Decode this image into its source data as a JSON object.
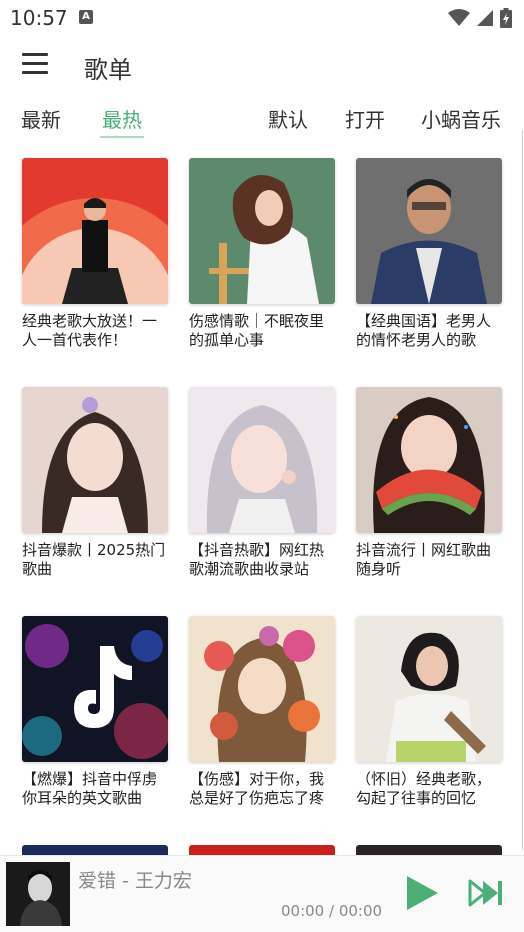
{
  "status_bar": {
    "time": "10:57",
    "a_badge": "A",
    "icons": [
      "wifi-icon",
      "cell-signal-icon",
      "battery-icon"
    ]
  },
  "header": {
    "title": "歌单",
    "menu_icon": "hamburger-menu-icon"
  },
  "tabs": {
    "left": [
      {
        "label": "最新"
      },
      {
        "label": "最热"
      }
    ],
    "right": [
      {
        "label": "默认"
      },
      {
        "label": "打开"
      },
      {
        "label": "小蜗音乐"
      }
    ],
    "active": "最热",
    "accent_color": "#4caf78"
  },
  "playlists": [
    {
      "title": "经典老歌大放送！一人一首代表作！"
    },
    {
      "title": "伤感情歌｜不眠夜里的孤单心事"
    },
    {
      "title": "【经典国语】老男人的情怀老男人的歌"
    },
    {
      "title": "抖音爆款丨2025热门歌曲"
    },
    {
      "title": "【抖音热歌】网红热歌潮流歌曲收录站"
    },
    {
      "title": "抖音流行丨网红歌曲随身听"
    },
    {
      "title": "【燃爆】抖音中俘虏你耳朵的英文歌曲"
    },
    {
      "title": "【伤感】对于你，我总是好了伤疤忘了疼"
    },
    {
      "title": "（怀旧）经典老歌，勾起了往事的回忆"
    }
  ],
  "player": {
    "song": "爱错 - 王力宏",
    "time": "00:00 / 00:00",
    "play_icon": "play-icon",
    "next_icon": "skip-next-icon",
    "accent_color": "#4caf78"
  }
}
